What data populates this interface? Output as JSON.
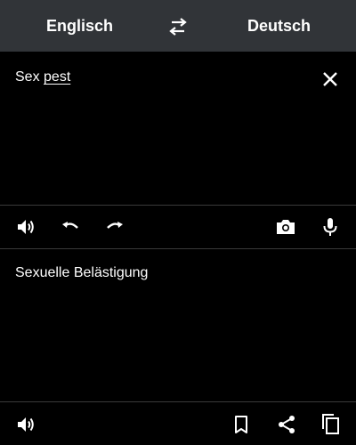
{
  "header": {
    "source_language": "Englisch",
    "target_language": "Deutsch"
  },
  "input": {
    "text_part1": "Sex ",
    "text_part2": "pest"
  },
  "output": {
    "text": "Sexuelle Belästigung"
  },
  "icons": {
    "swap": "swap-arrows-icon",
    "clear": "close-icon",
    "speaker": "speaker-icon",
    "undo": "undo-icon",
    "redo": "redo-icon",
    "camera": "camera-icon",
    "mic": "microphone-icon",
    "bookmark": "bookmark-icon",
    "share": "share-icon",
    "copy": "copy-icon"
  },
  "colors": {
    "header_bg": "#313438",
    "background": "#000000",
    "text": "#ffffff",
    "divider": "#3a3a3a"
  }
}
